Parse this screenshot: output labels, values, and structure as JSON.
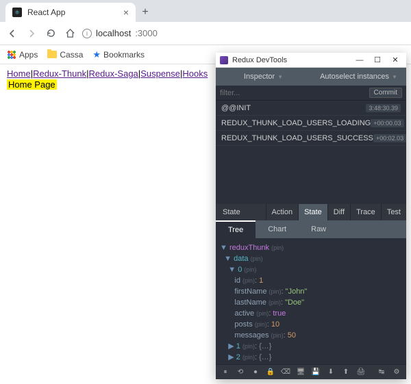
{
  "browser": {
    "tab_title": "React App",
    "url_host": "localhost",
    "url_port": ":3000",
    "bookmarks": {
      "apps": "Apps",
      "cassa": "Cassa",
      "bookmarks": "Bookmarks"
    }
  },
  "page": {
    "links": [
      "Home",
      "Redux-Thunk",
      "Redux-Saga",
      "Suspense",
      "Hooks"
    ],
    "title": "Home Page"
  },
  "devtools": {
    "title": "Redux DevTools",
    "inspector_label": "Inspector",
    "instances_label": "Autoselect instances",
    "filter_placeholder": "filter...",
    "commit_label": "Commit",
    "actions": [
      {
        "name": "@@INIT",
        "ts": "3:48:30.39"
      },
      {
        "name": "REDUX_THUNK_LOAD_USERS_LOADING",
        "ts": "+00:00.03"
      },
      {
        "name": "REDUX_THUNK_LOAD_USERS_SUCCESS",
        "ts": "+00:02.03"
      }
    ],
    "state_label": "State",
    "tabs1": [
      "Action",
      "State",
      "Diff",
      "Trace",
      "Test"
    ],
    "tabs1_active": "State",
    "tabs2": [
      "Tree",
      "Chart",
      "Raw"
    ],
    "tabs2_active": "Tree",
    "tree": {
      "root": "reduxThunk",
      "data_key": "data",
      "pin": "(pin)",
      "item0": {
        "idx": "0",
        "id_key": "id",
        "id_val": "1",
        "fn_key": "firstName",
        "fn_val": "\"John\"",
        "ln_key": "lastName",
        "ln_val": "\"Doe\"",
        "ac_key": "active",
        "ac_val": "true",
        "po_key": "posts",
        "po_val": "10",
        "me_key": "messages",
        "me_val": "50"
      },
      "item1": "1",
      "item2": "2",
      "collapsed": "{…}"
    }
  }
}
